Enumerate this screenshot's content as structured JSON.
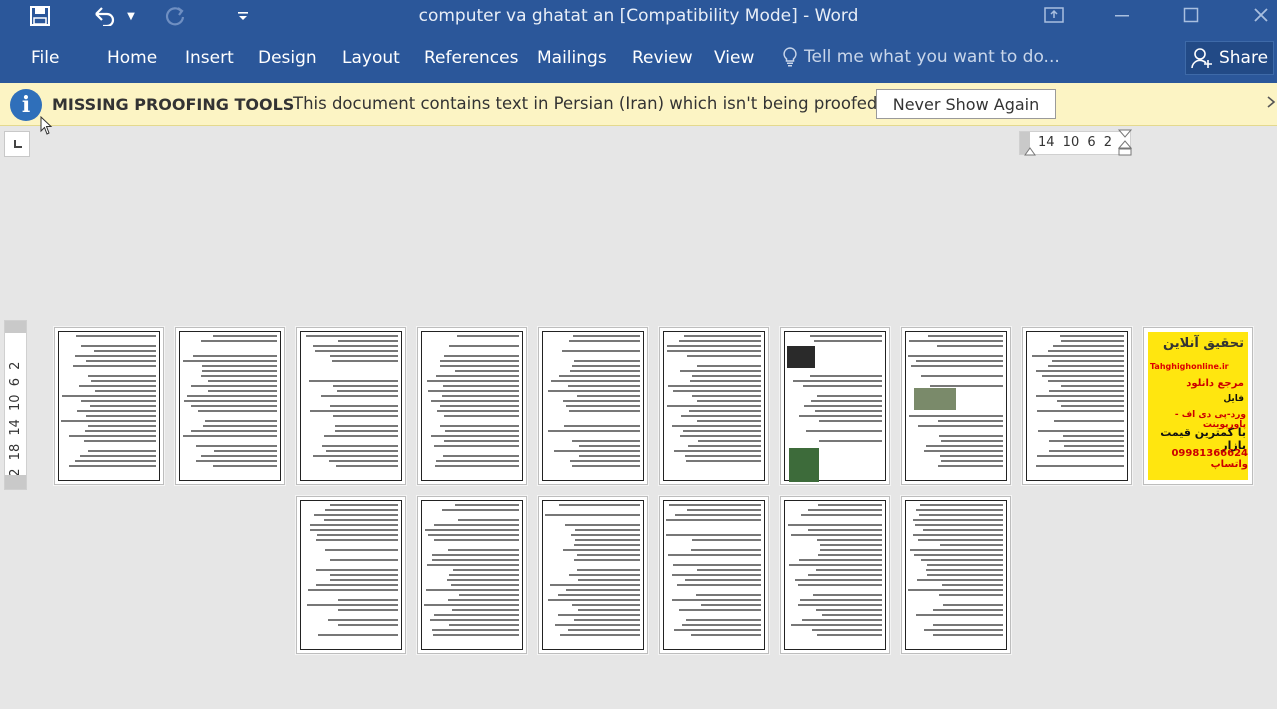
{
  "window": {
    "title": "computer va ghatat an [Compatibility Mode] - Word",
    "minimize_icon": "minimize-icon",
    "restore_icon": "restore-icon",
    "close_icon": "close-icon"
  },
  "qat": {
    "save_icon": "save-icon",
    "undo_icon": "undo-icon",
    "redo_icon": "redo-icon",
    "customize_icon": "customize-qat-icon"
  },
  "ribbon": {
    "tabs": [
      "File",
      "Home",
      "Insert",
      "Design",
      "Layout",
      "References",
      "Mailings",
      "Review",
      "View"
    ],
    "tell_me": "Tell me what you want to do...",
    "share": "Share"
  },
  "message_bar": {
    "title": "MISSING PROOFING TOOLS",
    "text": "This document contains text in Persian (Iran) which isn't being proofed.",
    "button": "Never Show Again"
  },
  "rulers": {
    "horizontal": "14 10 6 2",
    "vertical": "22 18 14 10 6 2",
    "vertical_top": "2"
  },
  "ad_page": {
    "title": "تحقیق آنلاین",
    "site": "Tahghighonline.ir",
    "line1": "مرجع دانلود",
    "line2": "فایل",
    "line3": "ورد-پی دی اف - پاورپوینت",
    "line4": "با کمترین قیمت بازار",
    "line5": "09981366624 واتساپ"
  },
  "colors": {
    "ribbon": "#2b579a",
    "message_bar": "#fcf4c4",
    "canvas": "#e6e6e6",
    "ad_background": "#ffe60f"
  }
}
